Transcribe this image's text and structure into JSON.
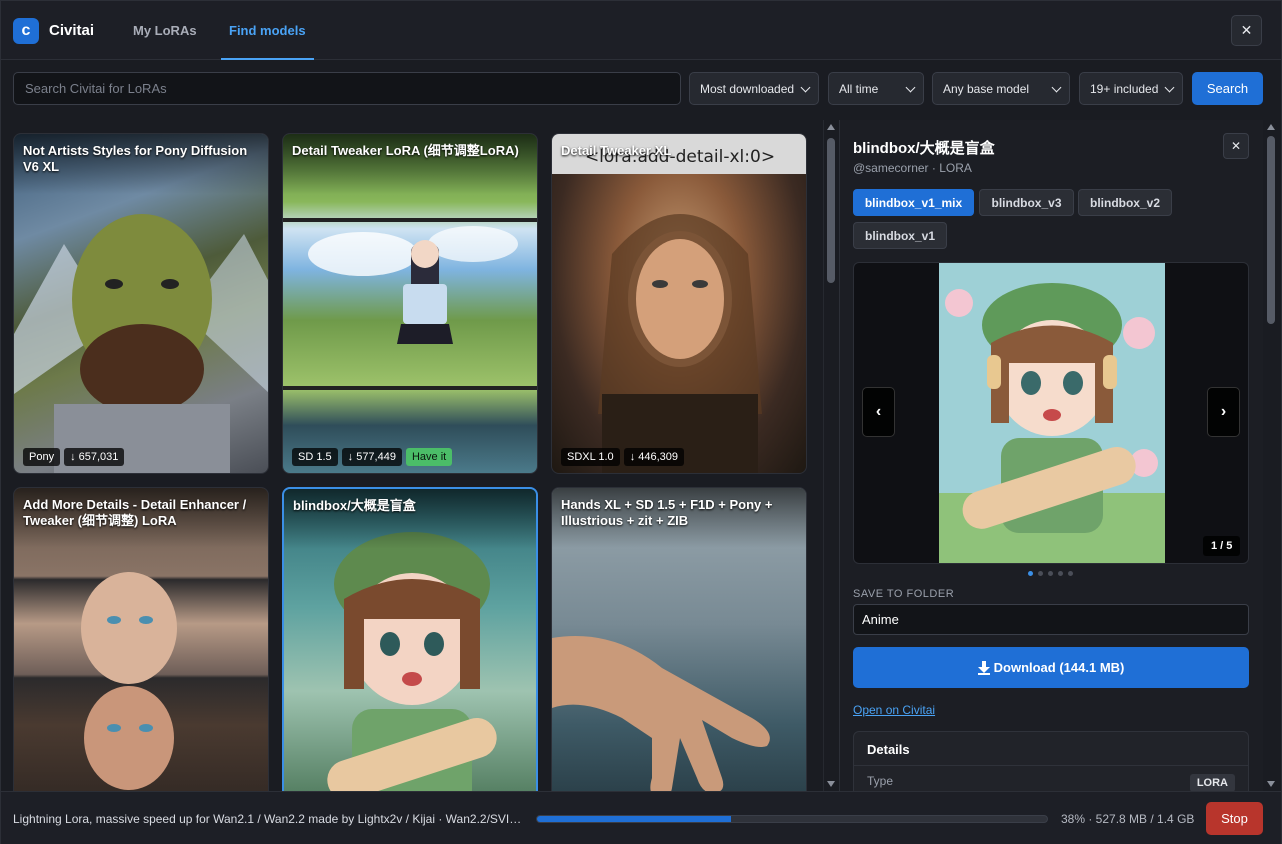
{
  "header": {
    "logo_letter": "c",
    "app_name": "Civitai",
    "tabs": [
      {
        "label": "My LoRAs",
        "active": false
      },
      {
        "label": "Find models",
        "active": true
      }
    ],
    "close_label": "✕"
  },
  "search": {
    "placeholder": "Search Civitai for LoRAs",
    "value": "",
    "sort": "Most downloaded",
    "period": "All time",
    "base_model": "Any base model",
    "nsfw": "19+ included",
    "button_label": "Search"
  },
  "cards": [
    {
      "title": "Not Artists Styles for Pony Diffusion V6 XL",
      "badges": [
        "Pony",
        "↓ 657,031"
      ],
      "have_it": false
    },
    {
      "title": "Detail Tweaker LoRA (细节调整LoRA)",
      "badges": [
        "SD 1.5",
        "↓ 577,449"
      ],
      "have_it": true,
      "have_label": "Have it"
    },
    {
      "title": "Detail Tweaker XL",
      "image_overlay_text": "<lora:add-detail-xl:0>",
      "badges": [
        "SDXL 1.0",
        "↓ 446,309"
      ],
      "have_it": false
    },
    {
      "title": "Add More Details - Detail Enhancer / Tweaker (细节调整) LoRA",
      "badges": [],
      "have_it": false
    },
    {
      "title": "blindbox/大概是盲盒",
      "badges": [],
      "have_it": false,
      "selected": true
    },
    {
      "title": "Hands XL + SD 1.5 + F1D + Pony + Illustrious + zit + ZIB",
      "badges": [],
      "have_it": false
    }
  ],
  "detail": {
    "title": "blindbox/大概是盲盒",
    "subtitle": "@samecorner · LORA",
    "close_label": "✕",
    "versions": [
      {
        "label": "blindbox_v1_mix",
        "active": true
      },
      {
        "label": "blindbox_v3",
        "active": false
      },
      {
        "label": "blindbox_v2",
        "active": false
      },
      {
        "label": "blindbox_v1",
        "active": false
      }
    ],
    "viewer": {
      "prev": "‹",
      "next": "›",
      "counter": "1 / 5",
      "current": 1,
      "total": 5
    },
    "save_label": "SAVE TO FOLDER",
    "folder_value": "Anime",
    "download_label": "Download (144.1 MB)",
    "open_link": "Open on Civitai",
    "details_title": "Details",
    "details": [
      {
        "key": "Type",
        "value": "LORA"
      }
    ]
  },
  "status": {
    "text": "Lightning Lora, massive speed up for Wan2.1 / Wan2.2 made by Lightx2v / Kijai · Wan2.2/SVI…",
    "progress_fraction": 0.38,
    "progress_text": "38% · 527.8 MB / 1.4 GB",
    "stop_label": "Stop"
  },
  "colors": {
    "accent": "#1f6fd6",
    "link": "#4aa3f5",
    "stop": "#b8352c",
    "have": "#4bbd68"
  },
  "icons": {
    "download": "download-icon",
    "close": "close-icon",
    "chevron": "chevron-down-icon"
  }
}
